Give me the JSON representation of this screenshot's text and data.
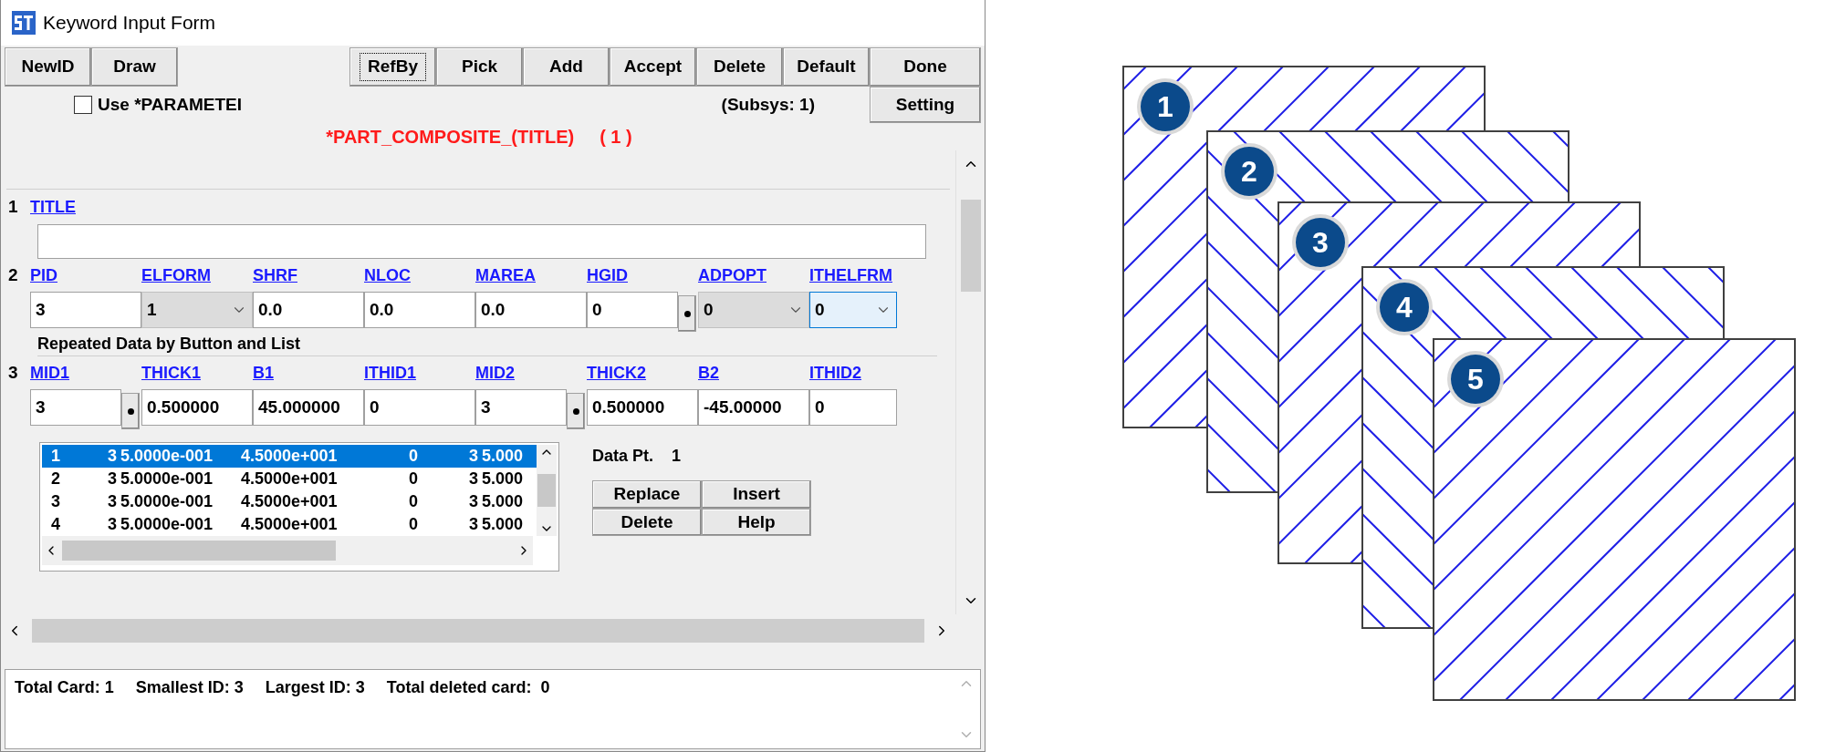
{
  "window": {
    "title": "Keyword Input Form"
  },
  "toolbar": {
    "left": [
      {
        "label": "NewID",
        "focused": false
      },
      {
        "label": "Draw",
        "focused": false
      }
    ],
    "right": [
      {
        "label": "RefBy",
        "focused": true
      },
      {
        "label": "Pick",
        "focused": false
      },
      {
        "label": "Add",
        "focused": false
      },
      {
        "label": "Accept",
        "focused": false
      },
      {
        "label": "Delete",
        "focused": false
      },
      {
        "label": "Default",
        "focused": false
      },
      {
        "label": "Done",
        "focused": false
      }
    ]
  },
  "use_parameter": {
    "label": "Use *PARAMETEI",
    "checked": false
  },
  "subsys": "(Subsys: 1)",
  "setting_button": "Setting",
  "keyword": {
    "name": "*PART_COMPOSITE_(TITLE)",
    "count": "( 1 )"
  },
  "title_card": {
    "number": "1",
    "label": "TITLE"
  },
  "card_2": {
    "number": "2",
    "fields": [
      {
        "label": "PID",
        "value": "3",
        "kind": "text",
        "focused": false
      },
      {
        "label": "ELFORM",
        "value": "1",
        "kind": "dropdown",
        "focused": false
      },
      {
        "label": "SHRF",
        "value": "0.0",
        "kind": "text",
        "focused": false
      },
      {
        "label": "NLOC",
        "value": "0.0",
        "kind": "text",
        "focused": false
      },
      {
        "label": "MAREA",
        "value": "0.0",
        "kind": "text",
        "focused": false
      },
      {
        "label": "HGID",
        "value": "0",
        "kind": "pick",
        "focused": false
      },
      {
        "label": "ADPOPT",
        "value": "0",
        "kind": "dropdown",
        "focused": false
      },
      {
        "label": "ITHELFRM",
        "value": "0",
        "kind": "dropdown",
        "focused": true
      }
    ]
  },
  "section_label": "Repeated Data by Button and List",
  "card_3": {
    "number": "3",
    "fields": [
      {
        "label": "MID1",
        "value": "3",
        "kind": "pick",
        "focused": false
      },
      {
        "label": "THICK1",
        "value": "0.500000",
        "kind": "text",
        "focused": false
      },
      {
        "label": "B1",
        "value": "45.000000",
        "kind": "text",
        "focused": false
      },
      {
        "label": "ITHID1",
        "value": "0",
        "kind": "text",
        "focused": false
      },
      {
        "label": "MID2",
        "value": "3",
        "kind": "pick",
        "focused": false
      },
      {
        "label": "THICK2",
        "value": "0.500000",
        "kind": "text",
        "focused": false
      },
      {
        "label": "B2",
        "value": "-45.00000",
        "kind": "text",
        "focused": false
      },
      {
        "label": "ITHID2",
        "value": "0",
        "kind": "text",
        "focused": false
      }
    ]
  },
  "data_list": {
    "rows": [
      {
        "cells": [
          "1",
          "3",
          "5.0000e-001",
          "4.5000e+001",
          "0",
          "3",
          "5.000"
        ],
        "selected": true
      },
      {
        "cells": [
          "2",
          "3",
          "5.0000e-001",
          "4.5000e+001",
          "0",
          "3",
          "5.000"
        ],
        "selected": false
      },
      {
        "cells": [
          "3",
          "3",
          "5.0000e-001",
          "4.5000e+001",
          "0",
          "3",
          "5.000"
        ],
        "selected": false
      },
      {
        "cells": [
          "4",
          "3",
          "5.0000e-001",
          "4.5000e+001",
          "0",
          "3",
          "5.000"
        ],
        "selected": false
      }
    ]
  },
  "data_point": {
    "label": "Data Pt.",
    "value": "1"
  },
  "list_buttons": [
    "Replace",
    "Insert",
    "Delete",
    "Help"
  ],
  "status": [
    "Total Card: 1",
    "Smallest ID: 3",
    "Largest ID: 3",
    "Total deleted card:  0"
  ],
  "diagram": {
    "plies": [
      {
        "label": "1",
        "kind": "ascending"
      },
      {
        "label": "2",
        "kind": "descending"
      },
      {
        "label": "3",
        "kind": "ascending"
      },
      {
        "label": "4",
        "kind": "descending"
      },
      {
        "label": "5",
        "kind": "ascending"
      }
    ]
  }
}
